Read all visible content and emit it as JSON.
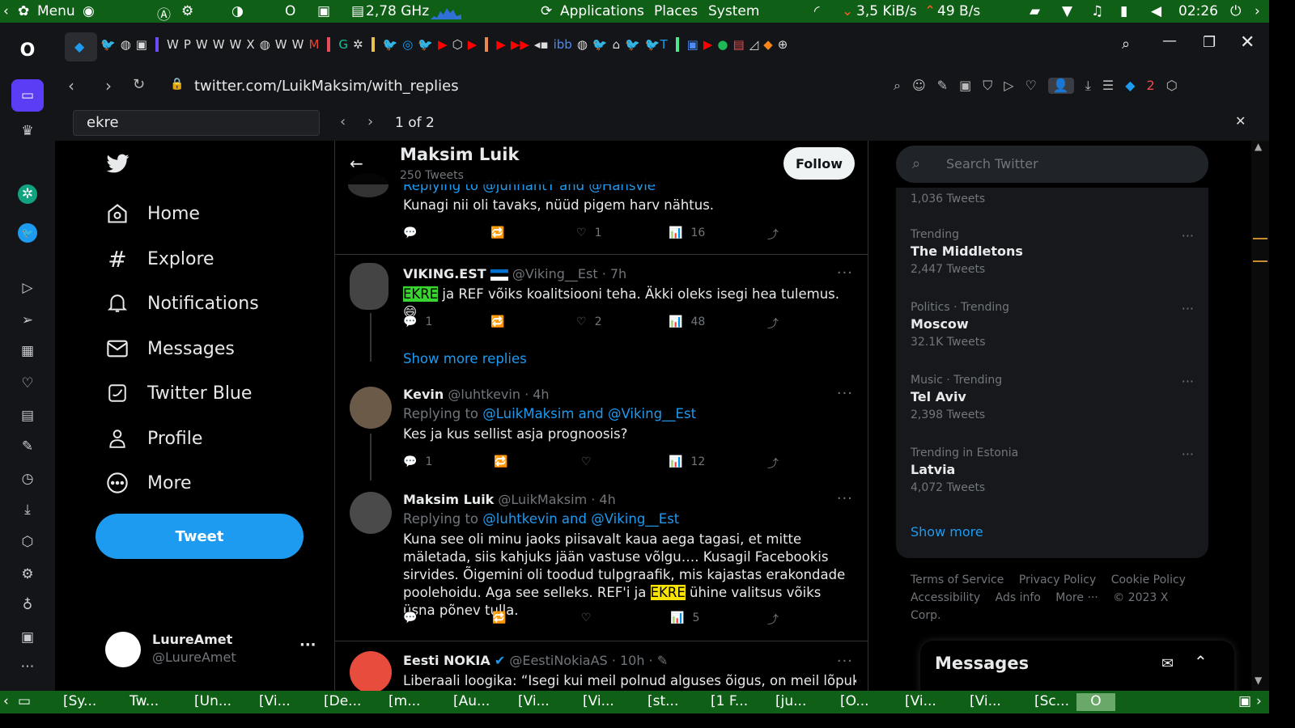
{
  "topbar": {
    "menu_label": "Menu",
    "cpu_freq": "2,78 GHz",
    "menus": [
      "Applications",
      "Places",
      "System"
    ],
    "net_down": "3,5 KiB/s",
    "net_up": "49 B/s",
    "clock": "02:26"
  },
  "address": {
    "url": "twitter.com/LuikMaksim/with_replies",
    "tab_count_badge": "2"
  },
  "find": {
    "query": "ekre",
    "result": "1 of 2"
  },
  "nav": {
    "items": [
      "Home",
      "Explore",
      "Notifications",
      "Messages",
      "Twitter Blue",
      "Profile",
      "More"
    ],
    "tweet_button": "Tweet",
    "account_name": "LuureAmet",
    "account_handle": "@LuureAmet",
    "account_more": "···"
  },
  "header": {
    "name": "Maksim Luik",
    "tweets": "250 Tweets",
    "follow": "Follow"
  },
  "tweets": [
    {
      "partial_reply": "Replying to @juhhantT and @Hansvie",
      "text": "Kunagi nii oli tavaks, nüüd pigem harv nähtus.",
      "replies": "",
      "retweets": "",
      "likes": "1",
      "views": "16"
    },
    {
      "name": "VIKING.EST",
      "flag": "EE",
      "handle": "@Viking__Est",
      "time": "· 7h",
      "highlight": "EKRE",
      "text": " ja REF võiks koalitsiooni teha. Äkki oleks isegi hea tulemus. 😄",
      "replies": "1",
      "retweets": "",
      "likes": "2",
      "views": "48"
    },
    {
      "show_more": "Show more replies"
    },
    {
      "name": "Kevin",
      "handle": "@luhtkevin",
      "time": "· 4h",
      "reply_prefix": "Replying to ",
      "reply_targets": "@LuikMaksim and @Viking__Est",
      "text": "Kes ja kus sellist asja prognoosis?",
      "replies": "1",
      "retweets": "",
      "likes": "",
      "views": "12"
    },
    {
      "name": "Maksim Luik",
      "handle": "@LuikMaksim",
      "time": "· 4h",
      "reply_prefix": "Replying to ",
      "reply_targets": "@luhtkevin and @Viking__Est",
      "text_before": "Kuna see oli minu jaoks piisavalt kaua aega tagasi, et mitte mäletada, siis kahjuks jään vastuse võlgu…. Kusagil Facebookis sirvides. Õigemini oli toodud tulpgraafik, mis kajastas erakondade poolehoidu. Aga see selleks. REF'i ja ",
      "highlight": "EKRE",
      "text_after": " ühine valitsus võiks üsna põnev tulla.",
      "replies": "",
      "retweets": "",
      "likes": "",
      "views": "5"
    },
    {
      "name": "Eesti NOKIA",
      "handle": "@EestiNokiaAS",
      "time": "· 10h ·",
      "text": "Liberaali loogika: “Isegi kui meil polnud alguses õigus, on meil lõpuks ikka"
    }
  ],
  "right": {
    "search_placeholder": "Search Twitter",
    "top_count": "1,036 Tweets",
    "trends": [
      {
        "cat": "Trending",
        "title": "The Middletons",
        "count": "2,447 Tweets"
      },
      {
        "cat": "Politics · Trending",
        "title": "Moscow",
        "count": "32.1K Tweets"
      },
      {
        "cat": "Music · Trending",
        "title": "Tel Aviv",
        "count": "2,398 Tweets"
      },
      {
        "cat": "Trending in Estonia",
        "title": "Latvia",
        "count": "4,072 Tweets"
      }
    ],
    "show_more": "Show more",
    "footer": [
      "Terms of Service",
      "Privacy Policy",
      "Cookie Policy",
      "Accessibility",
      "Ads info",
      "More ···",
      "© 2023 X Corp."
    ],
    "messages_title": "Messages"
  },
  "taskbar": {
    "items": [
      "[Sy...",
      "Tw...",
      "[Un...",
      "[Vi...",
      "[De...",
      "[m...",
      "[Au...",
      "[Vi...",
      "[Vi...",
      "[st...",
      "[1 F...",
      "[ju...",
      "[O...",
      "[Vi...",
      "[Vi...",
      "[Sc..."
    ]
  },
  "colors": {
    "accent": "#1d9bf0",
    "system_bar": "#0f5f17",
    "find_highlight_active": "#38d430",
    "find_highlight": "#f8e400"
  }
}
